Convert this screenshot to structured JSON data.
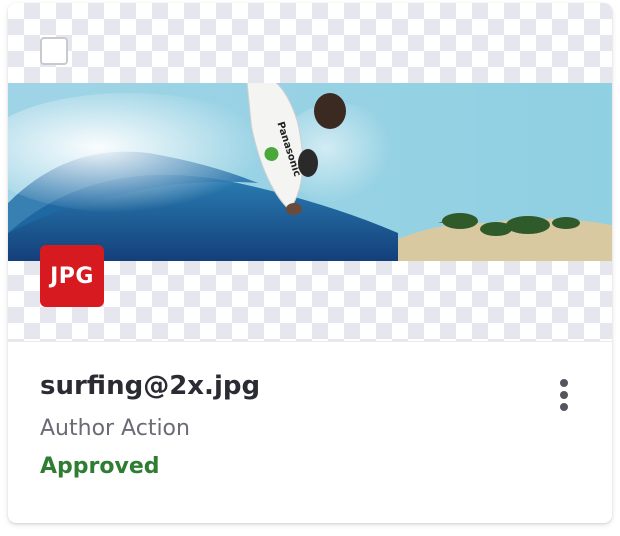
{
  "asset": {
    "file_type": "JPG",
    "file_name": "surfing@2x.jpg",
    "subtitle": "Author Action",
    "status": "Approved",
    "status_color": "#2e7d32",
    "badge_color": "#d71920",
    "thumbnail_text": "Panasonic",
    "selected": false
  },
  "icons": {
    "checkbox": "checkbox-unchecked-icon",
    "more": "more-vertical-icon"
  }
}
